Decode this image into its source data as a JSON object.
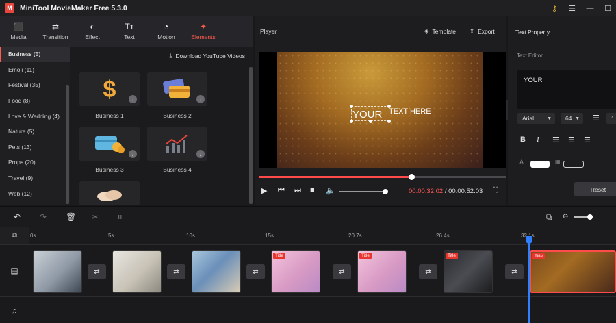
{
  "app": {
    "title": "MiniTool MovieMaker Free 5.3.0"
  },
  "toolbar": {
    "tabs": [
      {
        "label": "Media",
        "icon": "media-icon"
      },
      {
        "label": "Transition",
        "icon": "transition-icon"
      },
      {
        "label": "Effect",
        "icon": "effect-icon"
      },
      {
        "label": "Text",
        "icon": "text-icon"
      },
      {
        "label": "Motion",
        "icon": "motion-icon"
      },
      {
        "label": "Elements",
        "icon": "elements-icon",
        "active": true
      }
    ]
  },
  "categories": [
    {
      "label": "Business (5)",
      "active": true
    },
    {
      "label": "Emoji (11)"
    },
    {
      "label": "Festival (35)"
    },
    {
      "label": "Food (8)"
    },
    {
      "label": "Love & Wedding (4)"
    },
    {
      "label": "Nature (5)"
    },
    {
      "label": "Pets (13)"
    },
    {
      "label": "Props (20)"
    },
    {
      "label": "Travel (9)"
    },
    {
      "label": "Web (12)"
    }
  ],
  "library": {
    "download_label": "Download YouTube Videos",
    "items": [
      {
        "label": "Business 1",
        "icon": "dollar-icon"
      },
      {
        "label": "Business 2",
        "icon": "credit-card-icon"
      },
      {
        "label": "Business 3",
        "icon": "card-coins-icon"
      },
      {
        "label": "Business 4",
        "icon": "chart-icon"
      },
      {
        "label": "",
        "icon": "handshake-icon"
      }
    ]
  },
  "player": {
    "title": "Player",
    "template_label": "Template",
    "export_label": "Export",
    "overlay_text_1": "YOUR",
    "overlay_text_2": "TEXT HERE",
    "progress": 0.6156,
    "volume": 0.98,
    "current_time": "00:00:32.02",
    "separator": "/",
    "total_time": "00:00:52.03"
  },
  "properties": {
    "title": "Text Property",
    "editor_label": "Text Editor",
    "text_value": "YOUR",
    "font": "Arial",
    "size": "64",
    "line_spacing": "1",
    "text_color": "#ffffff",
    "reset_label": "Reset"
  },
  "timeline": {
    "ruler": [
      "0s",
      "5s",
      "10s",
      "15s",
      "20.7s",
      "26.4s",
      "32.1s"
    ],
    "clips": [
      {
        "kind": "image"
      },
      {
        "kind": "image"
      },
      {
        "kind": "image"
      },
      {
        "kind": "title",
        "tag": "Title"
      },
      {
        "kind": "title",
        "tag": "Title"
      },
      {
        "kind": "title",
        "tag": "Title"
      },
      {
        "kind": "title",
        "tag": "Title"
      }
    ]
  },
  "colors": {
    "accent": "#ff5a4f",
    "progress": "#ff4b4b",
    "playhead": "#2f7fff",
    "title_tag": "#e8352e"
  }
}
